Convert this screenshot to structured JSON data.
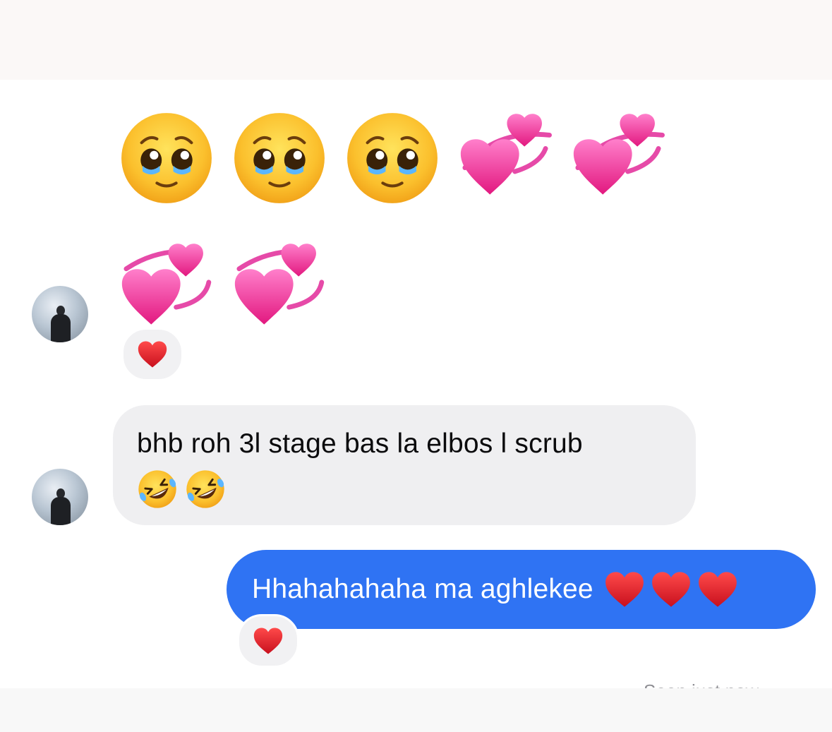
{
  "conversation": {
    "emoji_message": {
      "row1": [
        "pleading-face",
        "pleading-face",
        "pleading-face",
        "revolving-hearts",
        "revolving-hearts"
      ],
      "row2": [
        "revolving-hearts",
        "revolving-hearts"
      ],
      "reaction": "red-heart"
    },
    "incoming_message": {
      "text": "bhb roh 3l stage bas la elbos l scrub",
      "emojis": [
        "rolling-on-the-floor-laughing",
        "rolling-on-the-floor-laughing"
      ]
    },
    "outgoing_message": {
      "text": "Hhahahahaha ma aghlekee",
      "emojis": [
        "red-heart",
        "red-heart",
        "red-heart"
      ],
      "reaction": "red-heart"
    },
    "seen_status": "Seen just now"
  },
  "colors": {
    "outgoing_bubble": "#2f73f3",
    "incoming_bubble": "#efeff1",
    "heart": "#e8232f",
    "pink_heart": "#f04fa8"
  }
}
